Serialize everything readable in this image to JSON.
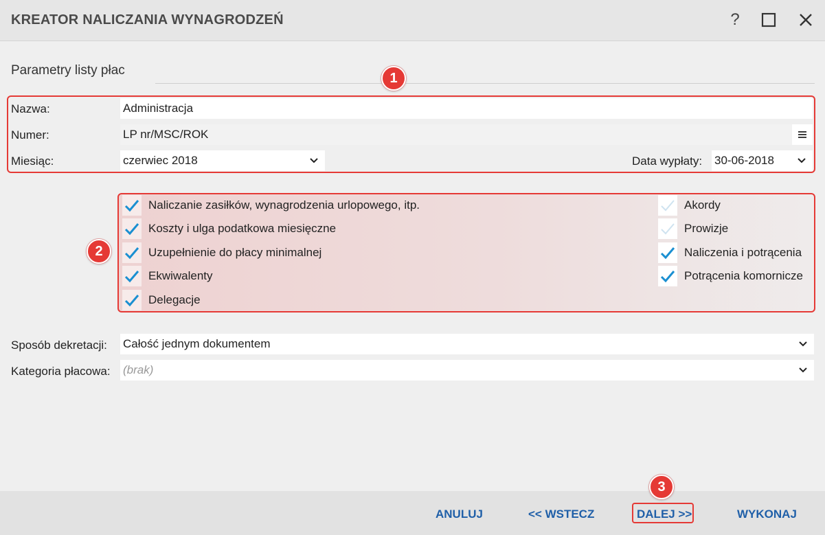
{
  "window": {
    "title": "KREATOR NALICZANIA WYNAGRODZEŃ",
    "help_label": "?"
  },
  "section": {
    "title": "Parametry listy płac"
  },
  "badges": {
    "one": "1",
    "two": "2",
    "three": "3"
  },
  "form": {
    "nazwa_label": "Nazwa:",
    "nazwa_value": "Administracja",
    "numer_label": "Numer:",
    "numer_value": "LP nr/MSC/ROK",
    "miesiac_label": "Miesiąc:",
    "miesiac_value": "czerwiec 2018",
    "data_wyplaty_label": "Data wypłaty:",
    "data_wyplaty_value": "30-06-2018"
  },
  "options_left": [
    {
      "label": "Naliczanie zasiłków, wynagrodzenia urlopowego, itp.",
      "checked": true
    },
    {
      "label": "Koszty i ulga podatkowa miesięczne",
      "checked": true
    },
    {
      "label": "Uzupełnienie do płacy minimalnej",
      "checked": true
    },
    {
      "label": "Ekwiwalenty",
      "checked": true
    },
    {
      "label": "Delegacje",
      "checked": true
    }
  ],
  "options_right": [
    {
      "label": "Akordy",
      "checked": false
    },
    {
      "label": "Prowizje",
      "checked": false
    },
    {
      "label": "Naliczenia i potrącenia",
      "checked": true
    },
    {
      "label": "Potrącenia komornicze",
      "checked": true
    }
  ],
  "lower": {
    "dekretacja_label": "Sposób dekretacji:",
    "dekretacja_value": "Całość jednym dokumentem",
    "kategoria_label": "Kategoria płacowa:",
    "kategoria_value": "(brak)"
  },
  "footer": {
    "cancel": "ANULUJ",
    "back": "<< WSTECZ",
    "next": "DALEJ >>",
    "execute": "WYKONAJ"
  },
  "colors": {
    "accent": "#1f5fa8",
    "highlight": "#e53935",
    "check": "#1a8fd1"
  }
}
